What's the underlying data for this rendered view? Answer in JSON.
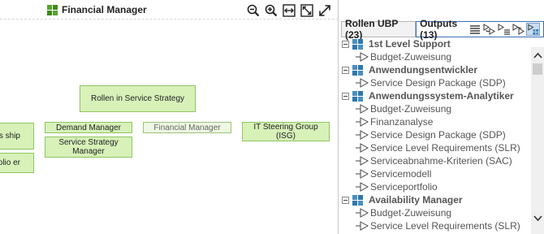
{
  "diagram": {
    "title": "Financial Manager",
    "tools": [
      "zoom-out-icon",
      "zoom-in-icon",
      "fit-width-icon",
      "fit-page-icon",
      "expand-icon"
    ],
    "nodes": {
      "rollen": "Rollen in Service Strategy",
      "left1": "ss ship",
      "left2": "rtfolio er",
      "demand": "Demand Manager",
      "ssm": "Service Strategy Manager",
      "financial": "Financial Manager",
      "itsg": "IT Steering Group (ISG)"
    }
  },
  "panel": {
    "tabs": {
      "rollen": "Rollen UBP (23)",
      "outputs": "Outputs (13)"
    },
    "tab_icons": [
      "list-icon",
      "output-tree-icon",
      "output-list-icon",
      "output-arrows-icon",
      "output-grid-icon"
    ],
    "tree": [
      {
        "group": "1st Level Support",
        "items": [
          "Budget-Zuweisung"
        ]
      },
      {
        "group": "Anwendungsentwickler",
        "items": [
          "Service Design Package (SDP)"
        ]
      },
      {
        "group": "Anwendungssystem-Analytiker",
        "items": [
          "Budget-Zuweisung",
          "Finanzanalyse",
          "Service Design Package (SDP)",
          "Service Level Requirements (SLR)",
          "Serviceabnahme-Kriterien (SAC)",
          "Servicemodell",
          "Serviceportfolio"
        ]
      },
      {
        "group": "Availability Manager",
        "items": [
          "Budget-Zuweisung",
          "Service Level Requirements (SLR)"
        ]
      }
    ]
  },
  "colors": {
    "node_fill": "#d7f1b9",
    "node_border": "#8fc55f",
    "active_tab_border": "#3a6fb2"
  }
}
